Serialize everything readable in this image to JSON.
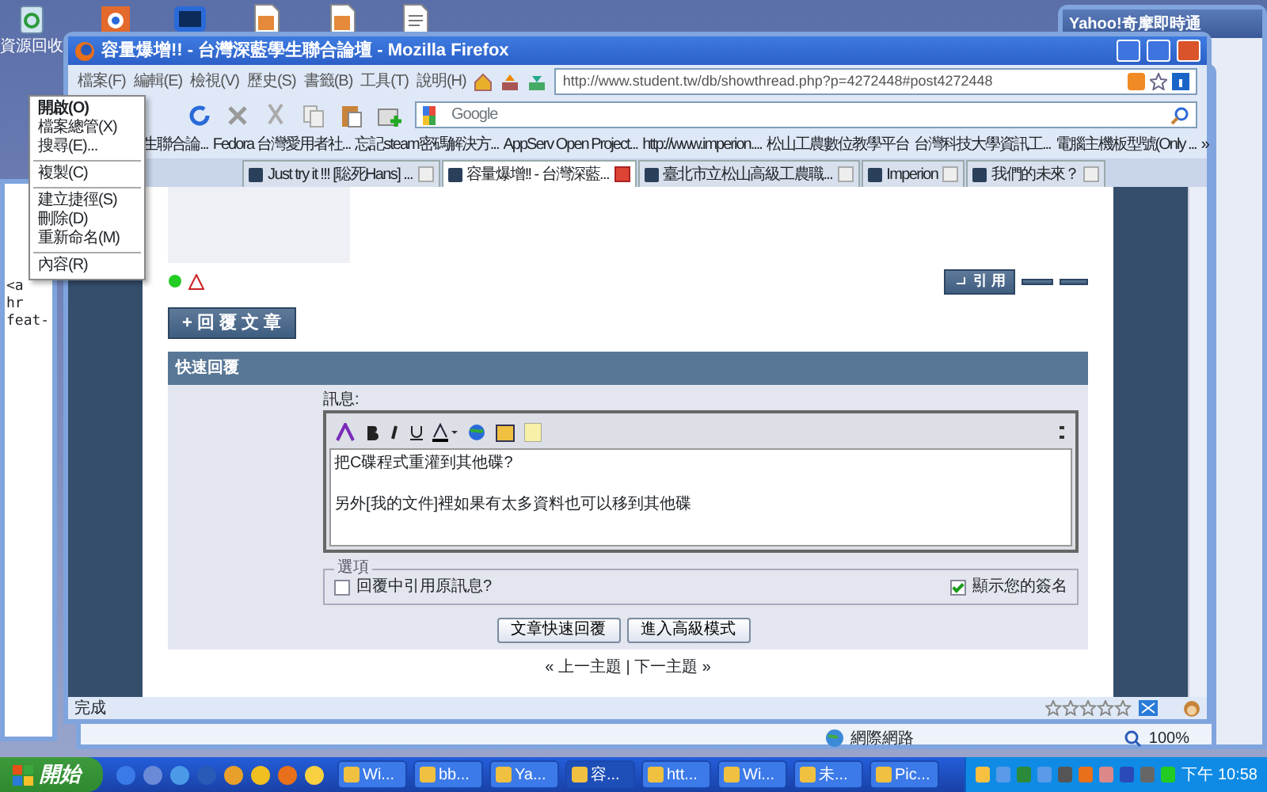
{
  "desktop": {
    "recycle_label": "資源回收"
  },
  "yahoo_window": {
    "title": "Yahoo!奇摩即時通"
  },
  "ie_window": {
    "zone": "網際網路",
    "zoom": "100%"
  },
  "editor_window": {
    "lines": [
      "<a",
      "hr",
      "feat-"
    ]
  },
  "firefox": {
    "title": "容量爆增!! - 台灣深藍學生聯合論壇 - Mozilla Firefox",
    "menu": [
      "檔案(F)",
      "編輯(E)",
      "檢視(V)",
      "歷史(S)",
      "書籤(B)",
      "工具(T)",
      "說明(H)"
    ],
    "url": "http://www.student.tw/db/showthread.php?p=4272448#post4272448",
    "search_placeholder": "Google",
    "bookmarks": [
      "生聯合論...",
      "Fedora 台灣愛用者社...",
      "忘記steam密碼解決方...",
      "AppServ Open Project...",
      "http://www.imperion....",
      "松山工農數位教學平台",
      "台灣科技大學資訊工...",
      "電腦主機板型號(Only ...",
      "»"
    ],
    "tabs": [
      {
        "label": "Just try it !!! [聡死Hans] ...",
        "selected": false
      },
      {
        "label": "容量爆增!! - 台灣深藍...",
        "selected": true
      },
      {
        "label": "臺北市立松山高級工農職...",
        "selected": false
      },
      {
        "label": "Imperion",
        "selected": false
      },
      {
        "label": "我們的未來？",
        "selected": false
      }
    ],
    "page": {
      "post_button": "引 用",
      "reply_button": "+ 回 覆 文 章",
      "quick_reply": {
        "title": "快速回覆",
        "message_label": "訊息:",
        "message": "把C碟程式重灌到其他碟?\n\n另外[我的文件]裡如果有太多資料也可以移到其他碟",
        "options_title": "選項",
        "options": [
          {
            "label": "回覆中引用原訊息?",
            "checked": false
          },
          {
            "label": "顯示您的簽名",
            "checked": true
          }
        ],
        "buttons": [
          "文章快速回覆",
          "進入高級模式"
        ]
      },
      "thread_nav": "« 上一主題 | 下一主題 »"
    },
    "status": "完成"
  },
  "context_menu": {
    "groups": [
      [
        {
          "label": "開啟(O)",
          "default": true
        },
        {
          "label": "檔案總管(X)",
          "default": false
        },
        {
          "label": "搜尋(E)...",
          "default": false
        }
      ],
      [
        {
          "label": "複製(C)",
          "default": false
        }
      ],
      [
        {
          "label": "建立捷徑(S)",
          "default": false
        },
        {
          "label": "刪除(D)",
          "default": false
        },
        {
          "label": "重新命名(M)",
          "default": false
        }
      ],
      [
        {
          "label": "內容(R)",
          "default": false
        }
      ]
    ]
  },
  "taskbar": {
    "start": "開始",
    "tasks": [
      {
        "label": "Wi...",
        "selected": false
      },
      {
        "label": "bb...",
        "selected": false
      },
      {
        "label": "Ya...",
        "selected": false
      },
      {
        "label": "容...",
        "selected": true
      },
      {
        "label": "htt...",
        "selected": false
      },
      {
        "label": "Wi...",
        "selected": false
      },
      {
        "label": "未...",
        "selected": false
      },
      {
        "label": "Pic...",
        "selected": false
      }
    ],
    "clock": "下午 10:58"
  }
}
